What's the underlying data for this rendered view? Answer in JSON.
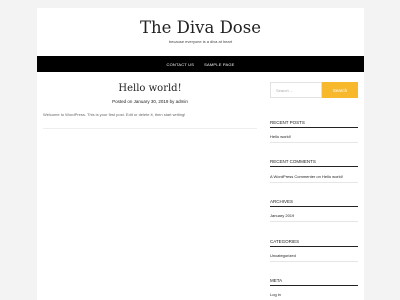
{
  "site": {
    "title": "The Diva Dose",
    "tagline": "because everyone is a diva at heart"
  },
  "nav": {
    "items": [
      "CONTACT US",
      "SAMPLE PAGE"
    ]
  },
  "post": {
    "title": "Hello world!",
    "meta_prefix": "Posted on ",
    "date": "January 30, 2019",
    "meta_by": " by ",
    "author": "admin",
    "content": "Welcome to WordPress. This is your first post. Edit or delete it, then start writing!"
  },
  "search": {
    "placeholder": "Search ...",
    "button_label": "Search"
  },
  "sidebar": {
    "recent_posts": {
      "title": "RECENT POSTS",
      "items": [
        "Hello world!"
      ]
    },
    "recent_comments": {
      "title": "RECENT COMMENTS",
      "commenter": "A WordPress Commenter",
      "on": " on ",
      "post": "Hello world!"
    },
    "archives": {
      "title": "ARCHIVES",
      "items": [
        "January 2019"
      ]
    },
    "categories": {
      "title": "CATEGORIES",
      "items": [
        "Uncategorized"
      ]
    },
    "meta": {
      "title": "META",
      "items": [
        "Log in"
      ]
    }
  },
  "colors": {
    "accent": "#f7b82c",
    "nav_bg": "#000000"
  }
}
